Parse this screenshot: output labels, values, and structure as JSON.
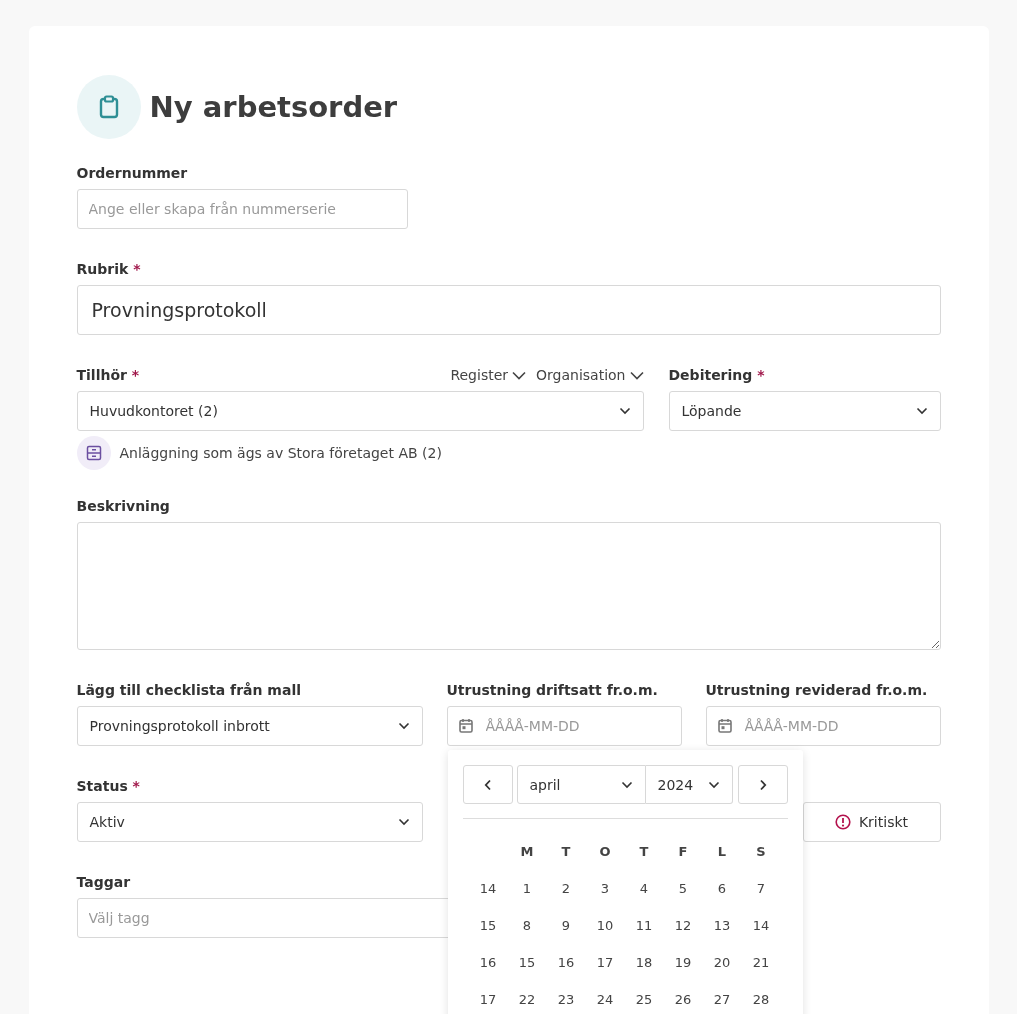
{
  "title": "Ny arbetsorder",
  "order_number": {
    "label": "Ordernummer",
    "placeholder": "Ange eller skapa från nummerserie"
  },
  "heading_field": {
    "label": "Rubrik",
    "required_mark": "*",
    "value": "Provningsprotokoll"
  },
  "belongs_to": {
    "label": "Tillhör",
    "required_mark": "*",
    "filters": [
      "Register",
      "Organisation"
    ],
    "value": "Huvudkontoret (2)",
    "info": "Anläggning som ägs av Stora företaget AB (2)"
  },
  "billing": {
    "label": "Debitering",
    "required_mark": "*",
    "value": "Löpande"
  },
  "description": {
    "label": "Beskrivning"
  },
  "checklist": {
    "label": "Lägg till checklista från mall",
    "value": "Provningsprotokoll inbrott"
  },
  "commissioned_from": {
    "label": "Utrustning driftsatt fr.o.m.",
    "placeholder": "ÅÅÅÅ-MM-DD"
  },
  "revised_from": {
    "label": "Utrustning reviderad fr.o.m.",
    "placeholder": "ÅÅÅÅ-MM-DD"
  },
  "status": {
    "label": "Status",
    "required_mark": "*",
    "value": "Aktiv"
  },
  "priority_buttons": [
    {
      "label": "Kritiskt"
    }
  ],
  "tags": {
    "label": "Taggar",
    "placeholder": "Välj tagg"
  },
  "calendar": {
    "month": "april",
    "year": "2024",
    "weekdays": [
      "M",
      "T",
      "O",
      "T",
      "F",
      "L",
      "S"
    ],
    "weeks": [
      {
        "week": "14",
        "days": [
          "1",
          "2",
          "3",
          "4",
          "5",
          "6",
          "7"
        ]
      },
      {
        "week": "15",
        "days": [
          "8",
          "9",
          "10",
          "11",
          "12",
          "13",
          "14"
        ]
      },
      {
        "week": "16",
        "days": [
          "15",
          "16",
          "17",
          "18",
          "19",
          "20",
          "21"
        ]
      },
      {
        "week": "17",
        "days": [
          "22",
          "23",
          "24",
          "25",
          "26",
          "27",
          "28"
        ]
      }
    ]
  }
}
